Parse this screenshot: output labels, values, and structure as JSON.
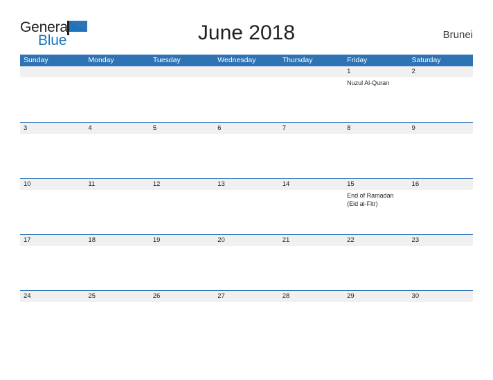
{
  "brand": {
    "name_part1": "General",
    "name_part2": "Blue",
    "flag_icon": "blue-flag-triangle-icon",
    "color_primary": "#1b75bc",
    "color_dark": "#231f20"
  },
  "header": {
    "title": "June 2018",
    "country": "Brunei"
  },
  "theme": {
    "header_blue": "#2e73b4",
    "band_gray": "#f0f0f0",
    "text_dark": "#231f20",
    "page_background": "#ffffff"
  },
  "calendar": {
    "weekdays": [
      "Sunday",
      "Monday",
      "Tuesday",
      "Wednesday",
      "Thursday",
      "Friday",
      "Saturday"
    ],
    "weeks": [
      {
        "days": [
          {
            "number": "",
            "events": []
          },
          {
            "number": "",
            "events": []
          },
          {
            "number": "",
            "events": []
          },
          {
            "number": "",
            "events": []
          },
          {
            "number": "",
            "events": []
          },
          {
            "number": "1",
            "events": [
              "Nuzul Al-Quran"
            ]
          },
          {
            "number": "2",
            "events": []
          }
        ]
      },
      {
        "days": [
          {
            "number": "3",
            "events": []
          },
          {
            "number": "4",
            "events": []
          },
          {
            "number": "5",
            "events": []
          },
          {
            "number": "6",
            "events": []
          },
          {
            "number": "7",
            "events": []
          },
          {
            "number": "8",
            "events": []
          },
          {
            "number": "9",
            "events": []
          }
        ]
      },
      {
        "days": [
          {
            "number": "10",
            "events": []
          },
          {
            "number": "11",
            "events": []
          },
          {
            "number": "12",
            "events": []
          },
          {
            "number": "13",
            "events": []
          },
          {
            "number": "14",
            "events": []
          },
          {
            "number": "15",
            "events": [
              "End of Ramadan",
              "(Eid al-Fitr)"
            ]
          },
          {
            "number": "16",
            "events": []
          }
        ]
      },
      {
        "days": [
          {
            "number": "17",
            "events": []
          },
          {
            "number": "18",
            "events": []
          },
          {
            "number": "19",
            "events": []
          },
          {
            "number": "20",
            "events": []
          },
          {
            "number": "21",
            "events": []
          },
          {
            "number": "22",
            "events": []
          },
          {
            "number": "23",
            "events": []
          }
        ]
      },
      {
        "days": [
          {
            "number": "24",
            "events": []
          },
          {
            "number": "25",
            "events": []
          },
          {
            "number": "26",
            "events": []
          },
          {
            "number": "27",
            "events": []
          },
          {
            "number": "28",
            "events": []
          },
          {
            "number": "29",
            "events": []
          },
          {
            "number": "30",
            "events": []
          }
        ]
      }
    ]
  }
}
